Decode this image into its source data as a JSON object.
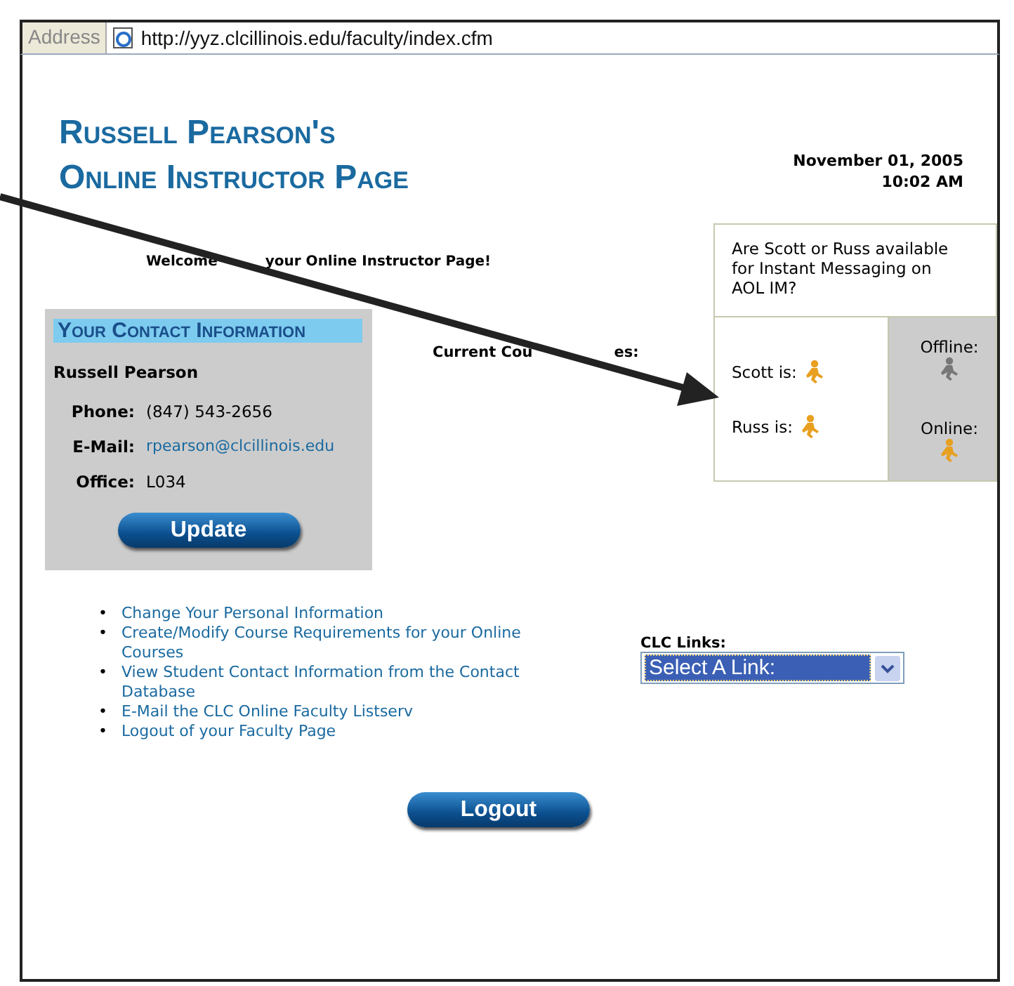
{
  "address_bar": {
    "label": "Address",
    "url": "http://yyz.clcillinois.edu/faculty/index.cfm"
  },
  "page": {
    "title_lines": [
      "Russell Pearson's",
      "Online Instructor Page"
    ],
    "date": "November 01, 2005",
    "time": "10:02 AM",
    "welcome": [
      "Welcome",
      "your Online Instructor Page!"
    ],
    "contact": {
      "heading": "Your Contact Information",
      "name": "Russell Pearson",
      "fields": [
        {
          "label": "Phone:",
          "value": "(847) 543-2656",
          "kind": "text"
        },
        {
          "label": "E-Mail:",
          "value": "rpearson@clcillinois.edu",
          "kind": "link"
        },
        {
          "label": "Office:",
          "value": "L034",
          "kind": "text"
        }
      ],
      "button": "Update"
    },
    "courses_label": [
      "Current Cou",
      "es:"
    ],
    "im_box": {
      "question": "Are Scott or Russ available for Instant Messaging on AOL IM?",
      "people": [
        {
          "label": "Scott is:",
          "online": true
        },
        {
          "label": "Russ is:",
          "online": true
        }
      ],
      "legend": [
        {
          "label": "Offline:",
          "online": false
        },
        {
          "label": "Online:",
          "online": true
        }
      ]
    },
    "links": [
      {
        "bullet": "•",
        "text": "Change Your Personal Information"
      },
      {
        "bullet": "•",
        "text": "Create/Modify Course Requirements for your Online Courses"
      },
      {
        "bullet": "•",
        "text": "View Student Contact Information from the Contact Database"
      },
      {
        "bullet": "•",
        "text": "E-Mail the CLC Online Faculty Listserv"
      },
      {
        "bullet": "•",
        "text": "Logout of your Faculty Page"
      }
    ],
    "clc_links": {
      "label": "CLC Links:",
      "value": "Select A Link:"
    },
    "logout_button": "Logout"
  },
  "annotation": {
    "kind": "arrow"
  }
}
